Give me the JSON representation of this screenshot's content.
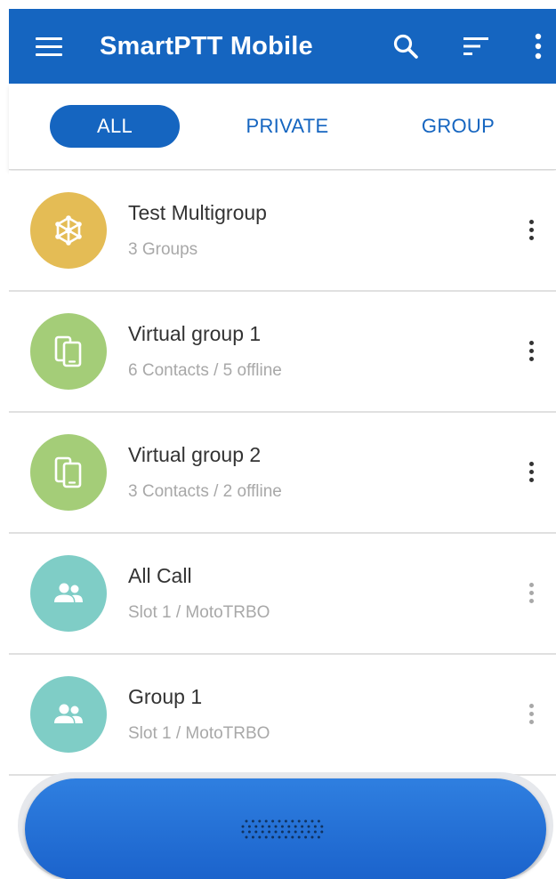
{
  "app_bar": {
    "title": "SmartPTT Mobile",
    "background": "#1565c0",
    "icons": [
      "menu-icon",
      "search-icon",
      "sort-icon",
      "more-vert-icon"
    ]
  },
  "tabs": [
    {
      "label": "ALL",
      "selected": true
    },
    {
      "label": "PRIVATE",
      "selected": false
    },
    {
      "label": "GROUP",
      "selected": false
    }
  ],
  "groups": [
    {
      "title": "Test Multigroup",
      "subtitle": "3 Groups",
      "icon": "multigroup-icon",
      "avatar_color": "#e4bc55"
    },
    {
      "title": "Virtual group 1",
      "subtitle": "6 Contacts / 5 offline",
      "icon": "devices-icon",
      "avatar_color": "#a4cd78"
    },
    {
      "title": "Virtual group 2",
      "subtitle": "3 Contacts / 2 offline",
      "icon": "devices-icon",
      "avatar_color": "#a4cd78"
    },
    {
      "title": "All Call",
      "subtitle": "Slot 1 / MotoTRBO",
      "icon": "group-icon",
      "avatar_color": "#7fcdc6"
    },
    {
      "title": "Group 1",
      "subtitle": "Slot 1 / MotoTRBO",
      "icon": "group-icon",
      "avatar_color": "#7fcdc6"
    }
  ],
  "ptt_button": {
    "icon": "grip-dots-icon",
    "color": "#1f6bd4"
  },
  "colors": {
    "accent": "#1565c0",
    "title_text": "#333333",
    "subtitle_text": "#a8a8a8",
    "divider": "#e0e0e0"
  }
}
